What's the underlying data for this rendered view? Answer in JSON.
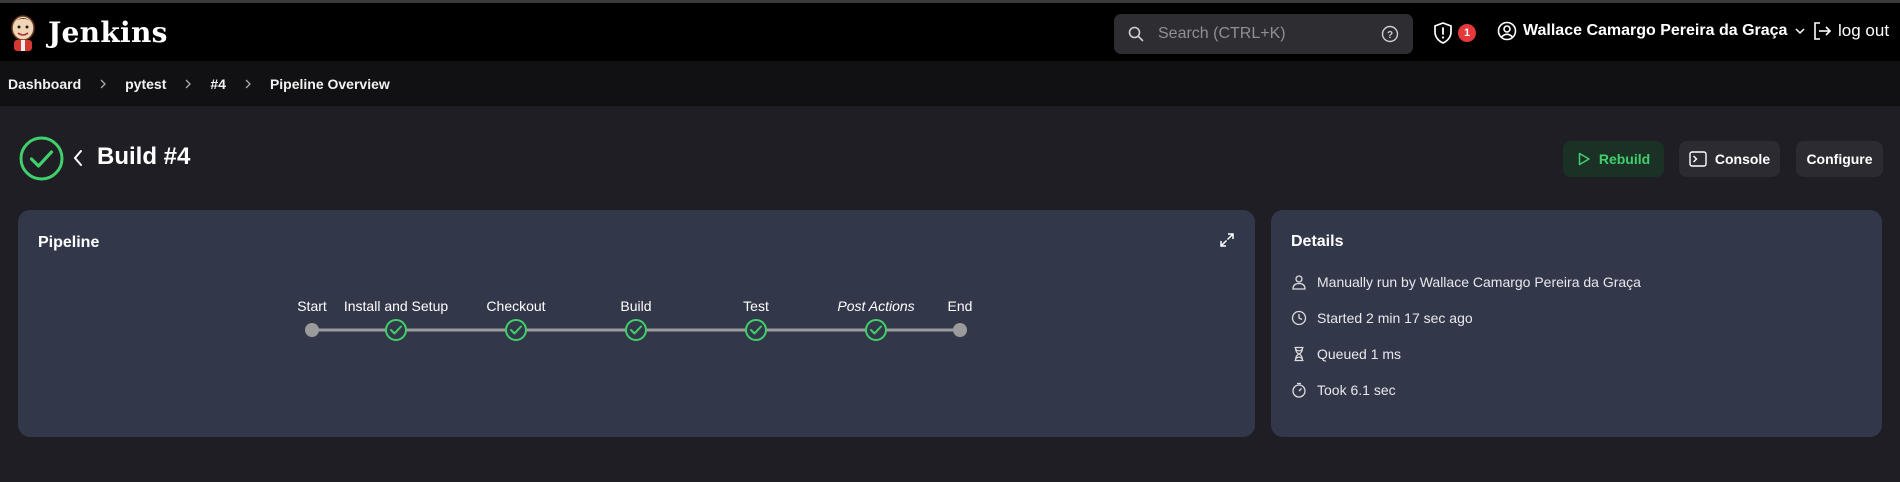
{
  "header": {
    "brand": "Jenkins",
    "search_placeholder": "Search (CTRL+K)",
    "alert_count": "1",
    "user_name": "Wallace Camargo Pereira da Graça",
    "logout_label": "log out"
  },
  "breadcrumb": [
    "Dashboard",
    "pytest",
    "#4",
    "Pipeline Overview"
  ],
  "build": {
    "title": "Build #4",
    "status": "success",
    "rebuild_label": "Rebuild",
    "console_label": "Console",
    "configure_label": "Configure"
  },
  "pipeline": {
    "title": "Pipeline",
    "stages": [
      {
        "label": "Start",
        "kind": "start",
        "italic": false
      },
      {
        "label": "Install and Setup",
        "kind": "success",
        "italic": false
      },
      {
        "label": "Checkout",
        "kind": "success",
        "italic": false
      },
      {
        "label": "Build",
        "kind": "success",
        "italic": false
      },
      {
        "label": "Test",
        "kind": "success",
        "italic": false
      },
      {
        "label": "Post Actions",
        "kind": "success",
        "italic": true
      },
      {
        "label": "End",
        "kind": "end",
        "italic": false
      }
    ]
  },
  "details": {
    "title": "Details",
    "items": [
      {
        "icon": "user-icon",
        "text": "Manually run by Wallace Camargo Pereira da Graça"
      },
      {
        "icon": "clock-icon",
        "text": "Started 2 min 17 sec ago"
      },
      {
        "icon": "hourglass-icon",
        "text": "Queued 1 ms"
      },
      {
        "icon": "timer-icon",
        "text": "Took 6.1 sec"
      }
    ]
  },
  "colors": {
    "success": "#3fd06b",
    "node_gray": "#9b9b9b",
    "card_bg": "#33374a",
    "alert_red": "#e5383b"
  }
}
